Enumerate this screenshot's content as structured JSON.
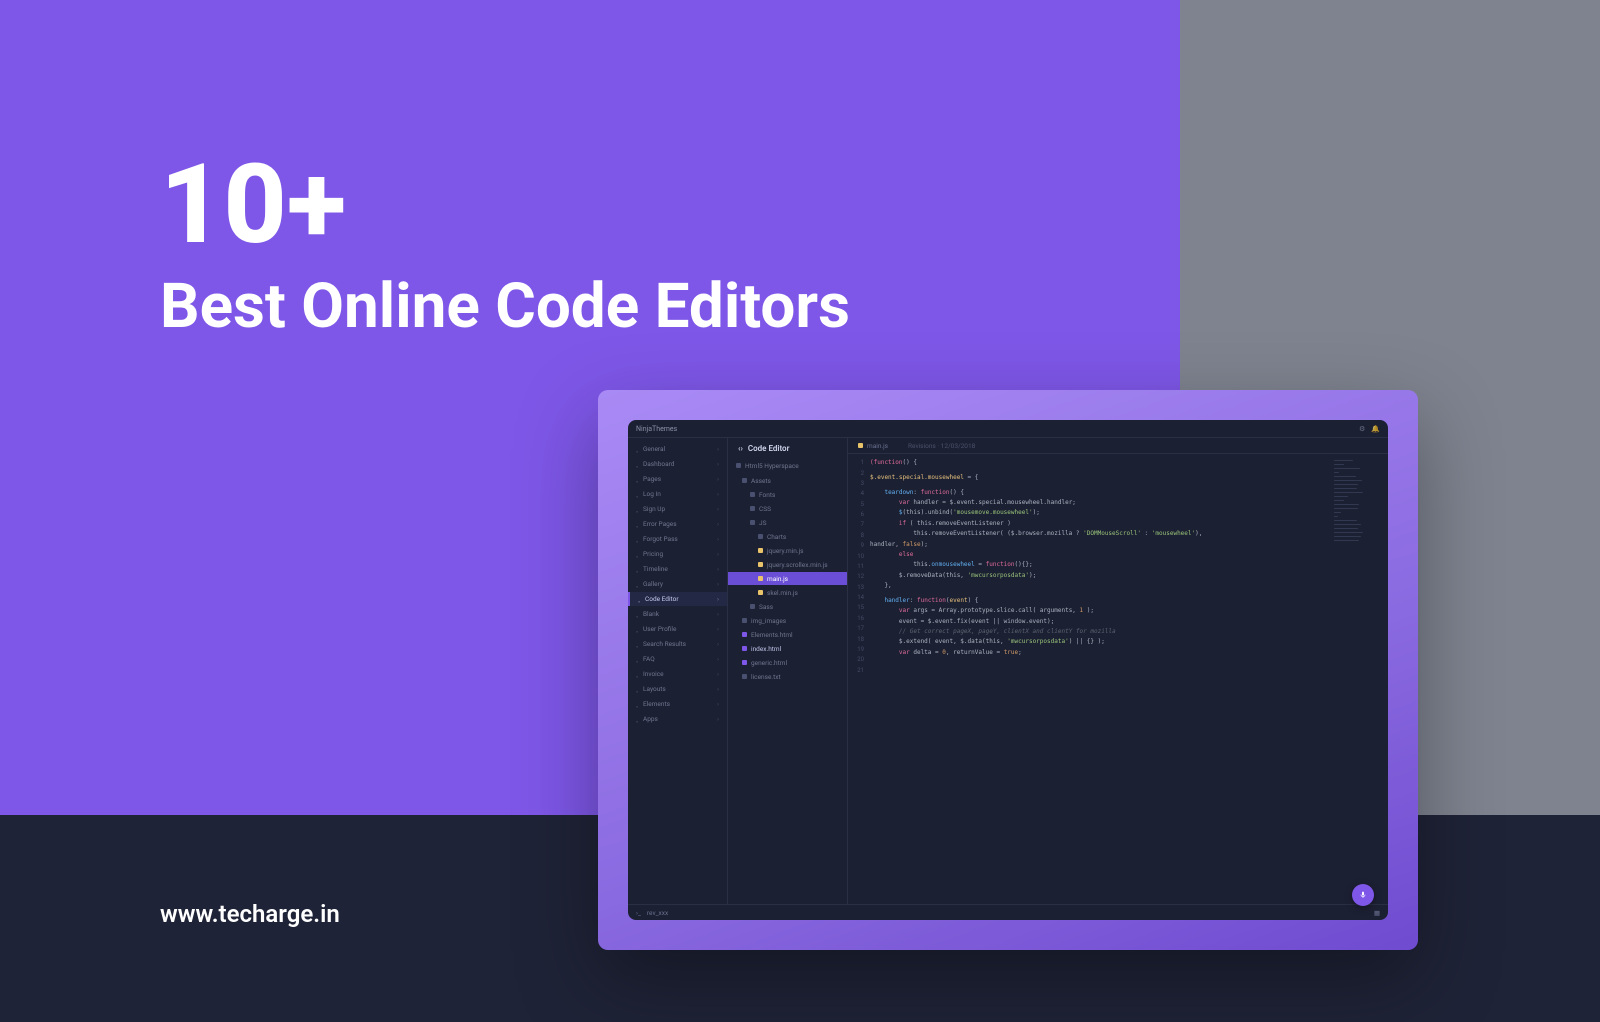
{
  "headline": {
    "big": "10+",
    "sub": "Best Online Code Editors"
  },
  "site_url": "www.techarge.in",
  "editor": {
    "brand": "NinjaThemes",
    "title": "Code Editor",
    "nav": [
      "General",
      "Dashboard",
      "Pages",
      "Log In",
      "Sign Up",
      "Error Pages",
      "Forgot Pass",
      "Pricing",
      "Timeline",
      "Gallery",
      "Code Editor",
      "Blank",
      "User Profile",
      "Search Results",
      "FAQ",
      "Invoice",
      "Layouts",
      "Elements",
      "Apps"
    ],
    "nav_active_index": 10,
    "tree_root": "Html5 Hyperspace",
    "tree": [
      {
        "label": "Assets",
        "lvl": 0,
        "type": "folder"
      },
      {
        "label": "Fonts",
        "lvl": 1,
        "type": "folder"
      },
      {
        "label": "CSS",
        "lvl": 1,
        "type": "folder"
      },
      {
        "label": "JS",
        "lvl": 1,
        "type": "folder"
      },
      {
        "label": "Charts",
        "lvl": 2,
        "type": "folder"
      },
      {
        "label": "jquery.min.js",
        "lvl": 2,
        "type": "js"
      },
      {
        "label": "jquery.scrollex.min.js",
        "lvl": 2,
        "type": "js"
      },
      {
        "label": "main.js",
        "lvl": 2,
        "type": "js",
        "hl": true
      },
      {
        "label": "skel.min.js",
        "lvl": 2,
        "type": "js"
      },
      {
        "label": "Sass",
        "lvl": 1,
        "type": "folder"
      },
      {
        "label": "img_images",
        "lvl": 0,
        "type": "folder"
      },
      {
        "label": "Elements.html",
        "lvl": 0,
        "type": "html"
      },
      {
        "label": "index.html",
        "lvl": 0,
        "type": "html",
        "hl2": true
      },
      {
        "label": "generic.html",
        "lvl": 0,
        "type": "html"
      },
      {
        "label": "license.txt",
        "lvl": 0,
        "type": "file"
      }
    ],
    "tab_main": "main.js",
    "tab_note": "Revisions · 12/03/2018",
    "status_label": "rev_xxx",
    "code": [
      [
        [
          "kw",
          "(function"
        ],
        [
          "pn",
          "()"
        ],
        [
          "pn",
          " {"
        ]
      ],
      [
        [
          "pn",
          ""
        ]
      ],
      [
        [
          "var",
          "$.event.special.mousewheel"
        ],
        [
          "pn",
          " = {"
        ]
      ],
      [
        [
          "pn",
          ""
        ]
      ],
      [
        [
          "pn",
          "    "
        ],
        [
          "fn",
          "teardown"
        ],
        [
          "pn",
          ": "
        ],
        [
          "kw",
          "function"
        ],
        [
          "pn",
          "() {"
        ]
      ],
      [
        [
          "pn",
          "        "
        ],
        [
          "kw",
          "var"
        ],
        [
          "pn",
          " handler = $.event.special.mousewheel.handler;"
        ]
      ],
      [
        [
          "pn",
          "        "
        ],
        [
          "fn",
          "$"
        ],
        [
          "pn",
          "(this).unbind("
        ],
        [
          "str",
          "'mousemove.mousewheel'"
        ],
        [
          "pn",
          ");"
        ]
      ],
      [
        [
          "pn",
          "        "
        ],
        [
          "kw",
          "if"
        ],
        [
          "pn",
          " ( this.removeEventListener )"
        ]
      ],
      [
        [
          "pn",
          "            this.removeEventListener( ($.browser.mozilla ? "
        ],
        [
          "str",
          "'DOMMouseScroll'"
        ],
        [
          "pn",
          " : "
        ],
        [
          "str",
          "'mousewheel'"
        ],
        [
          "pn",
          "),"
        ]
      ],
      [
        [
          "pn",
          "handler, "
        ],
        [
          "bool",
          "false"
        ],
        [
          "pn",
          ");"
        ]
      ],
      [
        [
          "pn",
          "        "
        ],
        [
          "kw",
          "else"
        ]
      ],
      [
        [
          "pn",
          "            this."
        ],
        [
          "fn",
          "onmousewheel"
        ],
        [
          "pn",
          " = "
        ],
        [
          "kw",
          "function"
        ],
        [
          "pn",
          "(){};"
        ]
      ],
      [
        [
          "pn",
          "        $.removeData(this, "
        ],
        [
          "str",
          "'mwcursorposdata'"
        ],
        [
          "pn",
          ");"
        ]
      ],
      [
        [
          "pn",
          "    },"
        ]
      ],
      [
        [
          "pn",
          ""
        ]
      ],
      [
        [
          "pn",
          "    "
        ],
        [
          "fn",
          "handler"
        ],
        [
          "pn",
          ": "
        ],
        [
          "kw",
          "function"
        ],
        [
          "pn",
          "("
        ],
        [
          "var",
          "event"
        ],
        [
          "pn",
          ") {"
        ]
      ],
      [
        [
          "pn",
          "        "
        ],
        [
          "kw",
          "var"
        ],
        [
          "pn",
          " args = Array.prototype.slice.call( arguments, "
        ],
        [
          "bool",
          "1"
        ],
        [
          "pn",
          " );"
        ]
      ],
      [
        [
          "pn",
          "        event = $.event.fix(event || window.event);"
        ]
      ],
      [
        [
          "pn",
          "        "
        ],
        [
          "cm",
          "// Get correct pageX, pageY, clientX and clientY for mozilla"
        ]
      ],
      [
        [
          "pn",
          "        $.extend( event, $.data(this, "
        ],
        [
          "str",
          "'mwcursorposdata'"
        ],
        [
          "pn",
          ") || {} );"
        ]
      ],
      [
        [
          "pn",
          "        "
        ],
        [
          "kw",
          "var"
        ],
        [
          "pn",
          " delta = "
        ],
        [
          "bool",
          "0"
        ],
        [
          "pn",
          ", returnValue = "
        ],
        [
          "bool",
          "true"
        ],
        [
          "pn",
          ";"
        ]
      ]
    ]
  }
}
